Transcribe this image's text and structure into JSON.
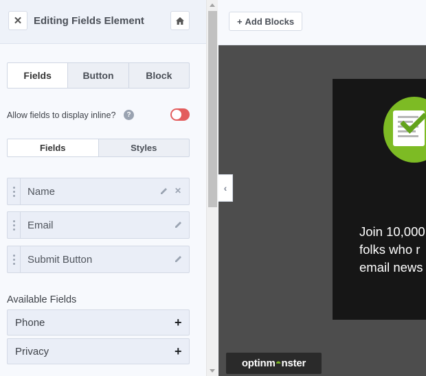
{
  "sidebar": {
    "title": "Editing Fields Element",
    "close_icon": "close-icon",
    "home_icon": "home-icon",
    "main_tabs": [
      {
        "label": "Fields",
        "active": true
      },
      {
        "label": "Button",
        "active": false
      },
      {
        "label": "Block",
        "active": false
      }
    ],
    "inline_option": {
      "label": "Allow fields to display inline?",
      "help_glyph": "?",
      "enabled": false
    },
    "sub_tabs": [
      {
        "label": "Fields",
        "active": true
      },
      {
        "label": "Styles",
        "active": false
      }
    ],
    "fields": [
      {
        "label": "Name",
        "actions": [
          "edit",
          "remove"
        ]
      },
      {
        "label": "Email",
        "actions": [
          "edit"
        ]
      },
      {
        "label": "Submit Button",
        "actions": [
          "edit"
        ]
      }
    ],
    "available_title": "Available Fields",
    "available": [
      {
        "label": "Phone",
        "action_glyph": "+"
      },
      {
        "label": "Privacy",
        "action_glyph": "+"
      }
    ]
  },
  "main": {
    "add_blocks_label": "Add Blocks",
    "add_blocks_glyph": "+",
    "collapse_glyph": "‹",
    "preview": {
      "lines": [
        "Join 10,000",
        "folks who r",
        "email news"
      ]
    },
    "brand": {
      "prefix": "optinm",
      "suffix": "nster"
    }
  },
  "colors": {
    "accent_toggle": "#e35d5d",
    "badge_green": "#7dbb24",
    "canvas_bg": "#4d4d4d",
    "preview_bg": "#161616"
  }
}
